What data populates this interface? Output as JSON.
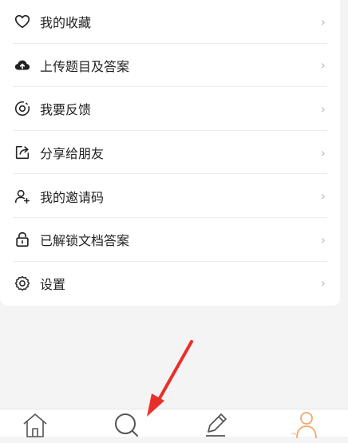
{
  "menu": {
    "items": [
      {
        "label": "我的收藏",
        "icon": "heart-icon"
      },
      {
        "label": "上传题目及答案",
        "icon": "cloud-upload-icon"
      },
      {
        "label": "我要反馈",
        "icon": "feedback-icon"
      },
      {
        "label": "分享给朋友",
        "icon": "share-icon"
      },
      {
        "label": "我的邀请码",
        "icon": "user-add-icon"
      },
      {
        "label": "已解锁文档答案",
        "icon": "lock-icon"
      },
      {
        "label": "设置",
        "icon": "gear-icon"
      }
    ],
    "chevron": "›"
  },
  "tabbar": {
    "tabs": [
      {
        "icon": "home-icon"
      },
      {
        "icon": "search-icon"
      },
      {
        "icon": "pencil-icon"
      },
      {
        "icon": "profile-icon"
      }
    ],
    "active_color": "#f5a66a"
  },
  "annotation": {
    "icon": "red-arrow-icon",
    "color": "#e8302a"
  }
}
